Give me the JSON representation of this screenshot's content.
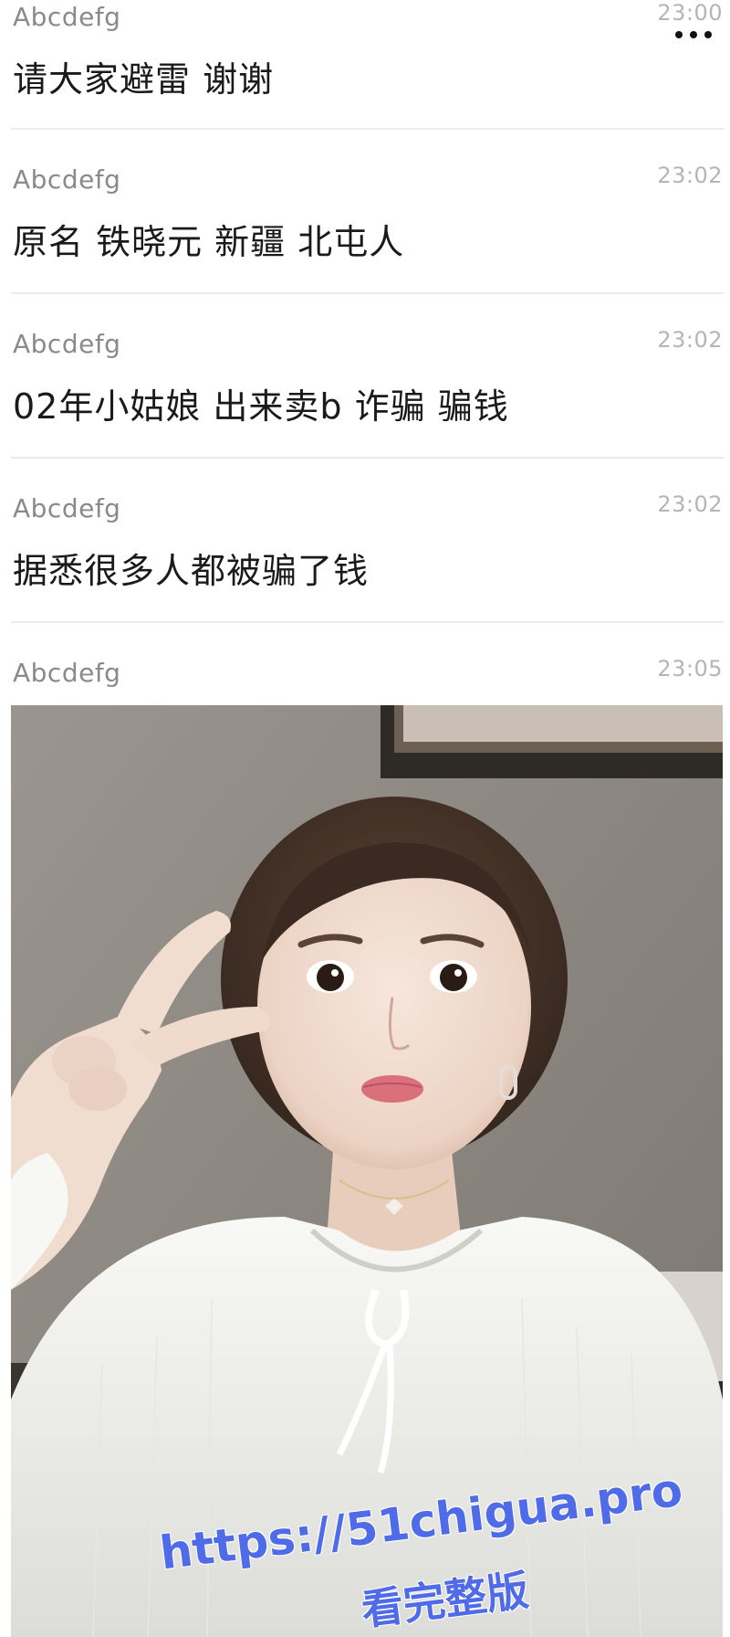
{
  "chat": {
    "messages": [
      {
        "sender": "Abcdefg",
        "time": "23:00",
        "text": "请大家避雷 谢谢"
      },
      {
        "sender": "Abcdefg",
        "time": "23:02",
        "text": "原名 铁晓元 新疆 北屯人"
      },
      {
        "sender": "Abcdefg",
        "time": "23:02",
        "text": "02年小姑娘 出来卖b 诈骗 骗钱"
      },
      {
        "sender": "Abcdefg",
        "time": "23:02",
        "text": "据悉很多人都被骗了钱"
      },
      {
        "sender": "Abcdefg",
        "time": "23:05"
      }
    ],
    "more_icon": "more-dots-icon"
  },
  "watermark": {
    "url": "https://51chigua.pro",
    "caption": "看完整版",
    "color": "#4f6be8"
  }
}
